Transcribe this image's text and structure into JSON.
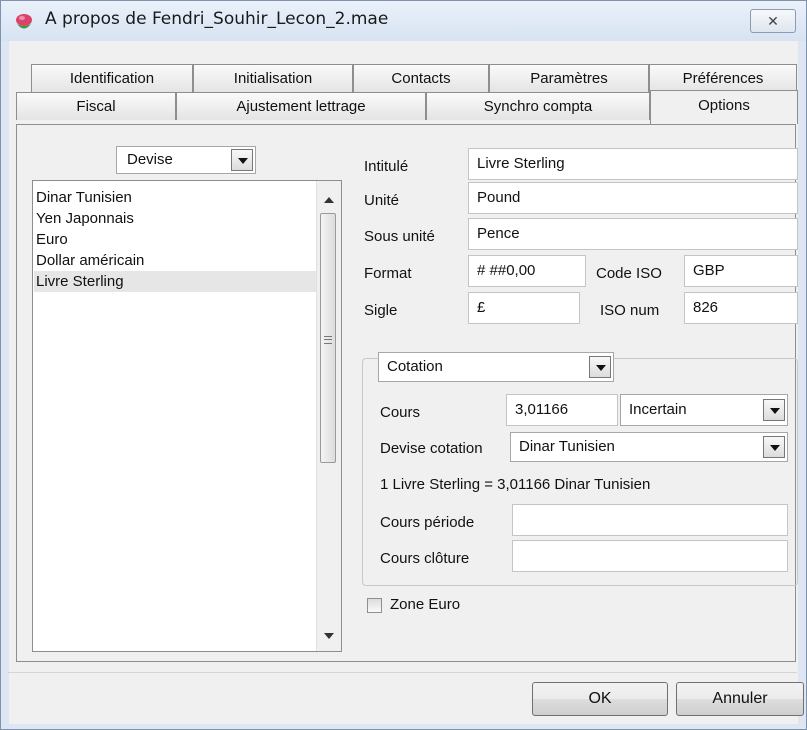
{
  "window": {
    "title": "A propos de Fendri_Souhir_Lecon_2.mae",
    "close_glyph": "✕"
  },
  "tabs": {
    "row1": [
      "Identification",
      "Initialisation",
      "Contacts",
      "Paramètres",
      "Préférences"
    ],
    "row2": [
      "Fiscal",
      "Ajustement lettrage",
      "Synchro compta",
      "Options"
    ],
    "active": "Options"
  },
  "currency_panel": {
    "filter_value": "Devise",
    "items": [
      "Dinar Tunisien",
      "Yen Japonnais",
      "Euro",
      "Dollar américain",
      "Livre Sterling"
    ],
    "selected": "Livre Sterling"
  },
  "form": {
    "intitule": {
      "label": "Intitulé",
      "value": "Livre Sterling"
    },
    "unite": {
      "label": "Unité",
      "value": "Pound"
    },
    "sous_unite": {
      "label": "Sous unité",
      "value": "Pence"
    },
    "format": {
      "label": "Format",
      "value": "# ##0,00"
    },
    "code_iso": {
      "label": "Code ISO",
      "value": "GBP"
    },
    "sigle": {
      "label": "Sigle",
      "value": "£"
    },
    "iso_num": {
      "label": "ISO num",
      "value": "826"
    }
  },
  "cotation": {
    "type_value": "Cotation",
    "cours": {
      "label": "Cours",
      "value": "3,01166",
      "mode": "Incertain"
    },
    "devise_cotation": {
      "label": "Devise cotation",
      "value": "Dinar Tunisien"
    },
    "conversion_text": "1 Livre Sterling = 3,01166 Dinar Tunisien",
    "cours_periode": {
      "label": "Cours période",
      "value": ""
    },
    "cours_cloture": {
      "label": "Cours clôture",
      "value": ""
    }
  },
  "zone_euro": {
    "label": "Zone Euro",
    "checked": false
  },
  "buttons": {
    "ok": "OK",
    "cancel": "Annuler"
  }
}
